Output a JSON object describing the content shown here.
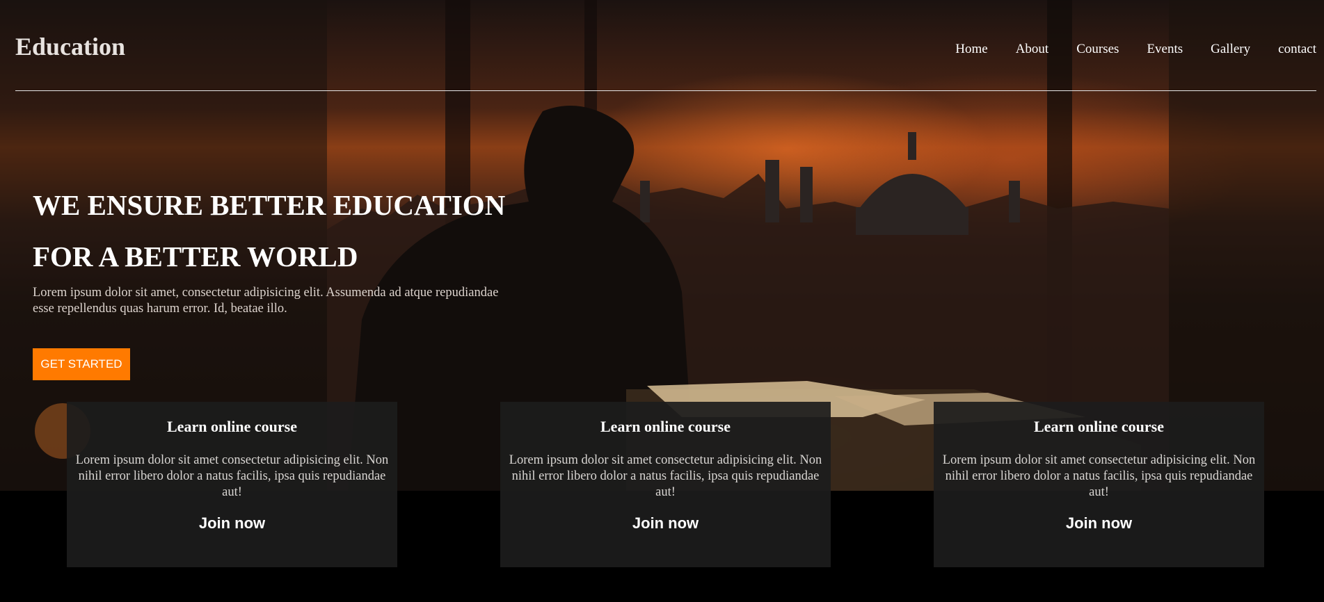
{
  "header": {
    "logo": "Education",
    "nav": [
      "Home",
      "About",
      "Courses",
      "Events",
      "Gallery",
      "contact"
    ]
  },
  "hero": {
    "headline_line1": "WE ENSURE BETTER EDUCATION",
    "headline_line2": "FOR A BETTER WORLD",
    "subtitle": "Lorem ipsum dolor sit amet, consectetur adipisicing elit. Assumenda ad atque repudiandae esse repellendus quas harum error. Id, beatae illo.",
    "cta_label": "GET STARTED"
  },
  "cards": [
    {
      "title": "Learn online course",
      "text": "Lorem ipsum dolor sit amet consectetur adipisicing elit. Non nihil error libero dolor a natus facilis, ipsa quis repudiandae aut!",
      "link": "Join now"
    },
    {
      "title": "Learn online course",
      "text": "Lorem ipsum dolor sit amet consectetur adipisicing elit. Non nihil error libero dolor a natus facilis, ipsa quis repudiandae aut!",
      "link": "Join now"
    },
    {
      "title": "Learn online course",
      "text": "Lorem ipsum dolor sit amet consectetur adipisicing elit. Non nihil error libero dolor a natus facilis, ipsa quis repudiandae aut!",
      "link": "Join now"
    }
  ],
  "colors": {
    "accent": "#ff7a00",
    "card_bg": "#1c1c1c",
    "page_bg": "#000000"
  }
}
